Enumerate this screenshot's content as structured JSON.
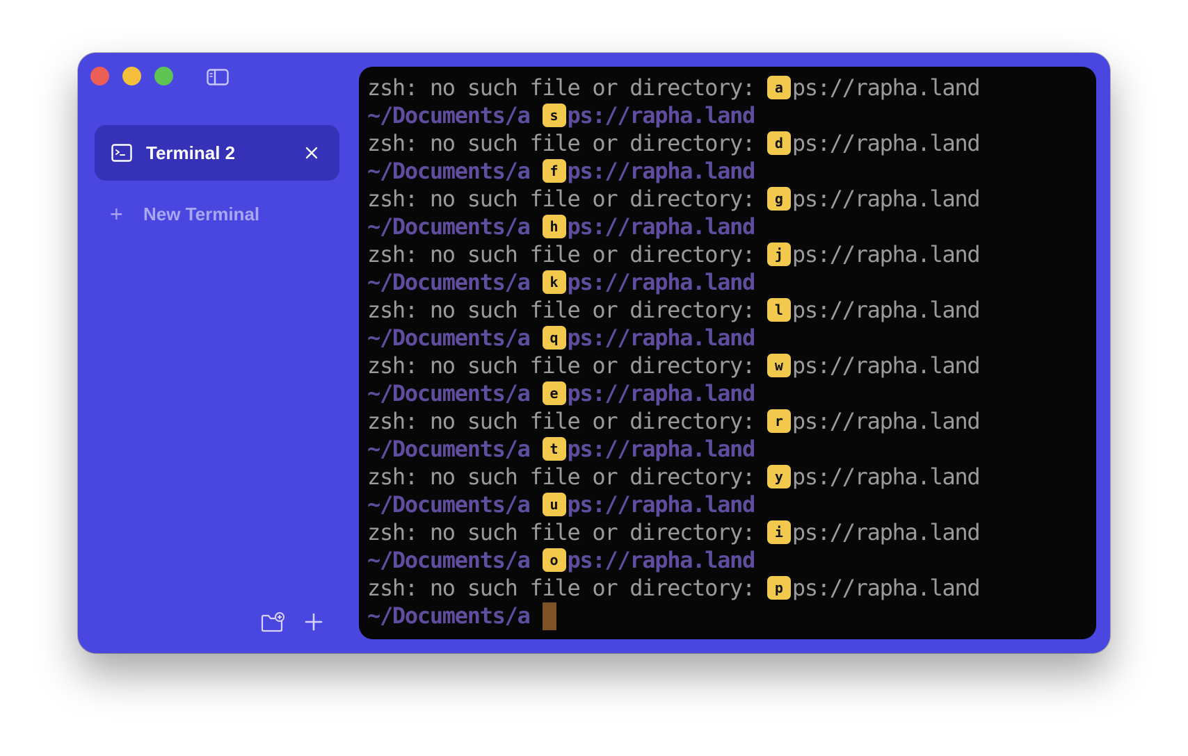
{
  "window": {
    "accent_color": "#4a47e0",
    "traffic_lights": [
      "close",
      "minimize",
      "zoom"
    ]
  },
  "sidebar": {
    "active_tab": {
      "icon": "terminal-icon",
      "label": "Terminal 2"
    },
    "new_terminal_label": "New Terminal",
    "footer_icons": [
      "new-folder-icon",
      "plus-icon"
    ]
  },
  "terminal": {
    "lines": [
      {
        "type": "err",
        "before": "zsh: no such file or directory: ",
        "hint": "a",
        "after": "tps://rapha.land"
      },
      {
        "type": "prompt",
        "before": "~/Documents/a ",
        "hint": "s",
        "after": "tps://rapha.land"
      },
      {
        "type": "err",
        "before": "zsh: no such file or directory: ",
        "hint": "d",
        "after": "tps://rapha.land"
      },
      {
        "type": "prompt",
        "before": "~/Documents/a ",
        "hint": "f",
        "after": "tps://rapha.land"
      },
      {
        "type": "err",
        "before": "zsh: no such file or directory: ",
        "hint": "g",
        "after": "tps://rapha.land"
      },
      {
        "type": "prompt",
        "before": "~/Documents/a ",
        "hint": "h",
        "after": "tps://rapha.land"
      },
      {
        "type": "err",
        "before": "zsh: no such file or directory: ",
        "hint": "j",
        "after": "tps://rapha.land"
      },
      {
        "type": "prompt",
        "before": "~/Documents/a ",
        "hint": "k",
        "after": "tps://rapha.land"
      },
      {
        "type": "err",
        "before": "zsh: no such file or directory: ",
        "hint": "l",
        "after": "tps://rapha.land"
      },
      {
        "type": "prompt",
        "before": "~/Documents/a ",
        "hint": "q",
        "after": "tps://rapha.land"
      },
      {
        "type": "err",
        "before": "zsh: no such file or directory: ",
        "hint": "w",
        "after": "tps://rapha.land"
      },
      {
        "type": "prompt",
        "before": "~/Documents/a ",
        "hint": "e",
        "after": "tps://rapha.land"
      },
      {
        "type": "err",
        "before": "zsh: no such file or directory: ",
        "hint": "r",
        "after": "tps://rapha.land"
      },
      {
        "type": "prompt",
        "before": "~/Documents/a ",
        "hint": "t",
        "after": "tps://rapha.land"
      },
      {
        "type": "err",
        "before": "zsh: no such file or directory: ",
        "hint": "y",
        "after": "tps://rapha.land"
      },
      {
        "type": "prompt",
        "before": "~/Documents/a ",
        "hint": "u",
        "after": "tps://rapha.land"
      },
      {
        "type": "err",
        "before": "zsh: no such file or directory: ",
        "hint": "i",
        "after": "tps://rapha.land"
      },
      {
        "type": "prompt",
        "before": "~/Documents/a ",
        "hint": "o",
        "after": "tps://rapha.land"
      },
      {
        "type": "err",
        "before": "zsh: no such file or directory: ",
        "hint": "p",
        "after": "tps://rapha.land"
      },
      {
        "type": "prompt",
        "before": "~/Documents/a ",
        "cursor": true
      }
    ],
    "colors": {
      "background": "#070707",
      "error_text": "#9b9b9b",
      "prompt_text": "#5f4ea0",
      "hint_badge": "#f2c94c",
      "cursor": "#7d5226"
    }
  }
}
